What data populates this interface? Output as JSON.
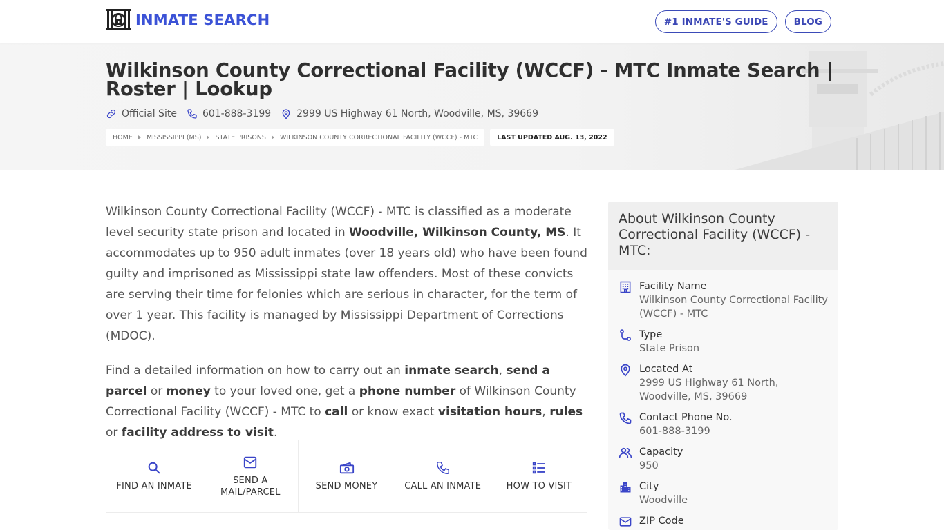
{
  "header": {
    "logo_text": "INMATE SEARCH",
    "nav": [
      {
        "label": "#1 INMATE'S GUIDE"
      },
      {
        "label": "BLOG"
      }
    ]
  },
  "hero": {
    "title": "Wilkinson County Correctional Facility (WCCF) - MTC Inmate Search | Roster | Lookup",
    "meta": {
      "official_site": "Official Site",
      "phone": "601-888-3199",
      "address": "2999 US Highway 61 North, Woodville, MS, 39669"
    },
    "breadcrumb": [
      {
        "label": "HOME"
      },
      {
        "label": "MISSISSIPPI (MS)"
      },
      {
        "label": "STATE PRISONS"
      },
      {
        "label": "WILKINSON COUNTY CORRECTIONAL FACILITY (WCCF) - MTC"
      }
    ],
    "last_updated": "LAST UPDATED AUG. 13, 2022"
  },
  "content": {
    "p1": {
      "t1": "Wilkinson County Correctional Facility (WCCF) - MTC is classified as a moderate level security state prison and located in ",
      "b1": "Woodville, Wilkinson County, MS",
      "t2": ". It accommodates up to 950 adult inmates (over 18 years old) who have been found guilty and imprisoned as Mississippi state law offenders. Most of these convicts are serving their time for felonies which are serious in character, for the term of over 1 year. This facility is managed by Mississippi Department of Corrections (MDOC)."
    },
    "p2": {
      "t1": "Find a detailed information on how to carry out an ",
      "b1": "inmate search",
      "t2": ", ",
      "b2": "send a parcel",
      "t3": " or ",
      "b3": "money",
      "t4": " to your loved one, get a ",
      "b4": "phone number",
      "t5": " of Wilkinson County Correctional Facility (WCCF) - MTC to ",
      "b5": "call",
      "t6": " or know exact ",
      "b6": "visitation hours",
      "t7": ", ",
      "b7": "rules",
      "t8": " or ",
      "b8": "facility address to visit",
      "t9": "."
    },
    "actions": [
      {
        "label": "FIND AN INMATE",
        "icon": "search-icon"
      },
      {
        "label": "SEND A MAIL/PARCEL",
        "icon": "mail-icon"
      },
      {
        "label": "SEND MONEY",
        "icon": "money-icon"
      },
      {
        "label": "CALL AN INMATE",
        "icon": "phone-icon"
      },
      {
        "label": "HOW TO VISIT",
        "icon": "list-icon"
      }
    ]
  },
  "sidebar": {
    "title": "About Wilkinson County Correctional Facility (WCCF) - MTC:",
    "items": [
      {
        "label": "Facility Name",
        "value": "Wilkinson County Correctional Facility (WCCF) - MTC",
        "icon": "building-icon"
      },
      {
        "label": "Type",
        "value": "State Prison",
        "icon": "route-icon"
      },
      {
        "label": "Located At",
        "value": "2999 US Highway 61 North, Woodville, MS, 39669",
        "icon": "map-pin-icon"
      },
      {
        "label": "Contact Phone No.",
        "value": "601-888-3199",
        "icon": "phone-icon"
      },
      {
        "label": "Capacity",
        "value": "950",
        "icon": "users-icon"
      },
      {
        "label": "City",
        "value": "Woodville",
        "icon": "city-icon"
      },
      {
        "label": "ZIP Code",
        "value": "",
        "icon": "mail-icon"
      }
    ]
  },
  "colors": {
    "brand": "#3b52d6",
    "nav_border": "#3b4bb8",
    "icon": "#3a45c8",
    "title": "#2f2f2f",
    "body_text": "#555555"
  }
}
